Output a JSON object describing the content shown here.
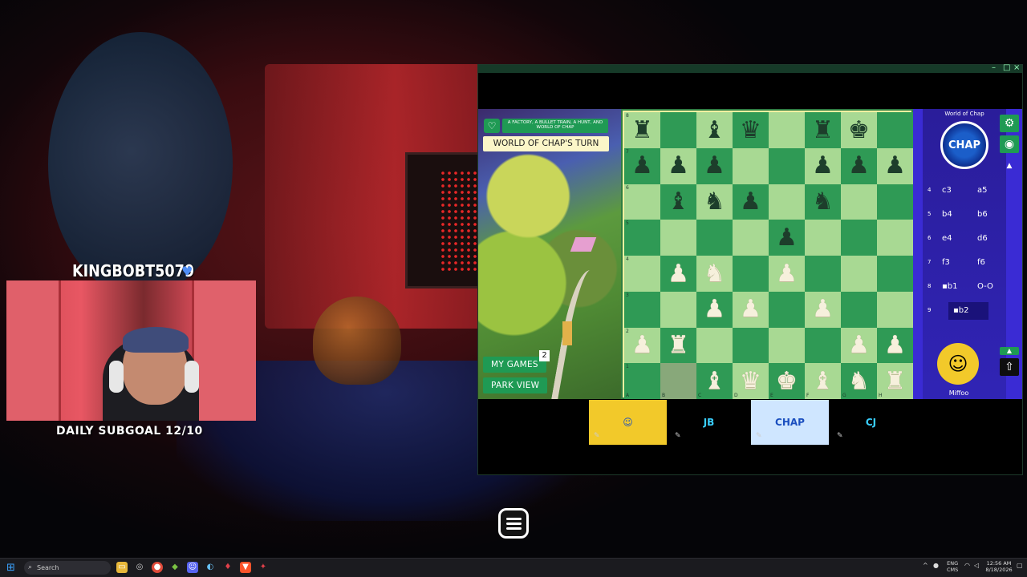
{
  "stream": {
    "streamer_name": "KINGBOBT5079",
    "subgoal": "DAILY SUBGOAL 12/10"
  },
  "game": {
    "subtitle": "A FACTORY, A BULLET TRAIN, A HUNT, AND WORLD OF CHAP",
    "turn_label": "WORLD OF CHAP'S TURN",
    "my_games_label": "MY GAMES",
    "my_games_count": "2",
    "park_view_label": "PARK VIEW",
    "opponent_name": "World of Chap",
    "opponent_logo_text": "CHAP",
    "player_name": "Miffoo",
    "board": [
      [
        "bR",
        "",
        "bB",
        "bQ",
        "",
        "bR",
        "bK",
        ""
      ],
      [
        "bP",
        "bP",
        "bP",
        "",
        "",
        "bP",
        "bP",
        "bP"
      ],
      [
        "",
        "bB",
        "bN",
        "bP",
        "",
        "bN",
        "",
        ""
      ],
      [
        "",
        "",
        "",
        "",
        "bP",
        "",
        "",
        ""
      ],
      [
        "",
        "wP",
        "wN",
        "",
        "wP",
        "",
        "",
        ""
      ],
      [
        "",
        "",
        "wP",
        "wP",
        "",
        "wP",
        "",
        ""
      ],
      [
        "wP",
        "wR",
        "",
        "",
        "",
        "",
        "wP",
        "wP"
      ],
      [
        "",
        "",
        "wB",
        "wQ",
        "wK",
        "wB",
        "wN",
        "wR"
      ]
    ],
    "highlight_square": "b1",
    "ranks": [
      "8",
      "7",
      "6",
      "5",
      "4",
      "3",
      "2",
      "1"
    ],
    "files": [
      "A",
      "B",
      "C",
      "D",
      "E",
      "F",
      "G",
      "H"
    ],
    "moves": [
      {
        "num": "4",
        "white": "c3",
        "black": "a5"
      },
      {
        "num": "5",
        "white": "b4",
        "black": "b6"
      },
      {
        "num": "6",
        "white": "e4",
        "black": "d6"
      },
      {
        "num": "7",
        "white": "f3",
        "black": "f6"
      },
      {
        "num": "8",
        "white": "▪b1",
        "black": "O-O"
      },
      {
        "num": "9",
        "white": "▪b2",
        "black": ""
      }
    ],
    "active_move_index": 5,
    "dock": [
      {
        "name": "Miffoo",
        "bg": "#f2c92a"
      },
      {
        "name": "JB",
        "bg": "#000000"
      },
      {
        "name": "CHAP",
        "bg": "#cfe6ff"
      },
      {
        "name": "CJ",
        "bg": "#000000"
      }
    ]
  },
  "taskbar": {
    "search_placeholder": "Search",
    "lang_top": "ENG",
    "lang_bottom": "CMS",
    "time": "12:56 AM",
    "date": "8/18/2026"
  },
  "colors": {
    "board_light": "#a8d993",
    "board_dark": "#2f9a55",
    "accent_green": "#1f9a54",
    "side_panel": "#3024b5"
  }
}
